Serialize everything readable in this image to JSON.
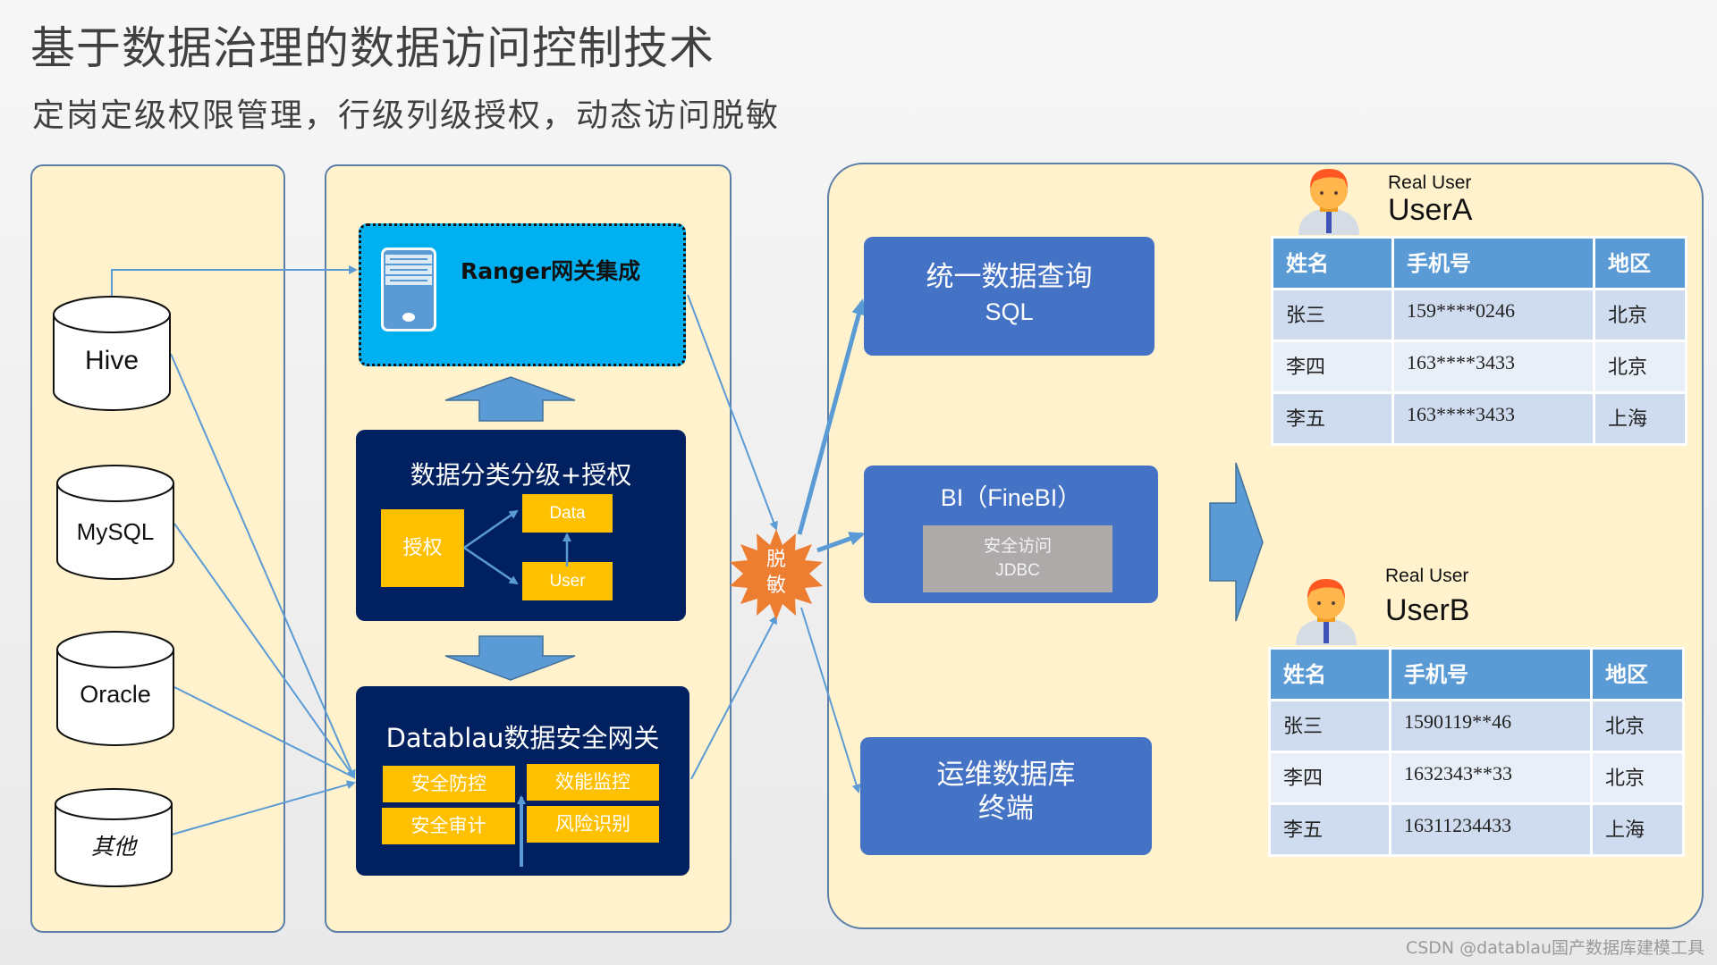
{
  "header": {
    "title": "基于数据治理的数据访问控制技术",
    "subtitle": "定岗定级权限管理，行级列级授权，动态访问脱敏"
  },
  "sources": {
    "databases": [
      {
        "label": "Hive"
      },
      {
        "label": "MySQL"
      },
      {
        "label": "Oracle"
      },
      {
        "label": "其他"
      }
    ]
  },
  "gateway": {
    "ranger": {
      "label": "Ranger网关集成",
      "icon": "server-icon"
    },
    "classify": {
      "title": "数据分类分级+授权",
      "authorize": "授权",
      "data": "Data",
      "user": "User"
    },
    "datablau": {
      "title": "Datablau数据安全网关",
      "features": [
        "安全防控",
        "效能监控",
        "安全审计",
        "风险识别"
      ]
    }
  },
  "masking": {
    "line1": "脱",
    "line2": "敏"
  },
  "apps": {
    "sql": {
      "line1": "统一数据查询",
      "line2": "SQL"
    },
    "bi": {
      "title": "BI（FineBI）",
      "inner_line1": "安全访问",
      "inner_line2": "JDBC"
    },
    "ops": {
      "line1": "运维数据库",
      "line2": "终端"
    }
  },
  "users": [
    {
      "caption": "Real User",
      "name": "UserA",
      "columns": [
        "姓名",
        "手机号",
        "地区"
      ],
      "rows": [
        [
          "张三",
          "159****0246",
          "北京"
        ],
        [
          "李四",
          "163****3433",
          "北京"
        ],
        [
          "李五",
          "163****3433",
          "上海"
        ]
      ]
    },
    {
      "caption": "Real User",
      "name": "UserB",
      "columns": [
        "姓名",
        "手机号",
        "地区"
      ],
      "rows": [
        [
          "张三",
          "1590119**46",
          "北京"
        ],
        [
          "李四",
          "1632343**33",
          "北京"
        ],
        [
          "李五",
          "16311234433",
          "上海"
        ]
      ]
    }
  ],
  "colors": {
    "panel_fill": "#fff2cc",
    "navy": "#002060",
    "accent_yellow": "#ffc000",
    "ranger_blue": "#00b0f0",
    "app_blue": "#4472c4",
    "arrow_blue": "#5b9bd5",
    "masking_orange": "#ed7d31"
  },
  "footer": {
    "watermark": "CSDN @datablau国产数据库建模工具"
  }
}
